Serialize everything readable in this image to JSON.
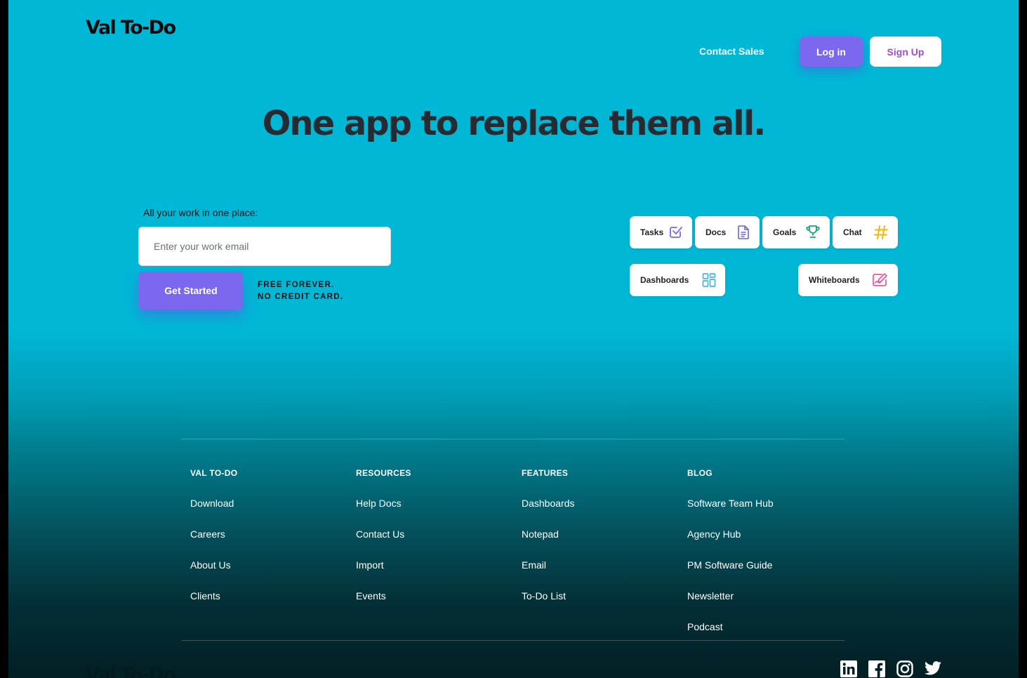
{
  "brand": {
    "name": "Val To-Do"
  },
  "nav": {
    "contact_sales": "Contact Sales",
    "login": "Log in",
    "signup": "Sign Up"
  },
  "hero": {
    "title": "One app to replace them all.",
    "email_label": "All your work in one place:",
    "email_placeholder": "Enter your work email",
    "cta": "Get Started",
    "note_line1": "FREE FOREVER.",
    "note_line2": "NO CREDIT CARD."
  },
  "features": [
    {
      "label": "Tasks",
      "icon": "check-square-icon",
      "color": "#7b68ee"
    },
    {
      "label": "Docs",
      "icon": "document-icon",
      "color": "#6e63d9"
    },
    {
      "label": "Goals",
      "icon": "trophy-icon",
      "color": "#1aa877"
    },
    {
      "label": "Chat",
      "icon": "hashtag-icon",
      "color": "#f7b500"
    },
    {
      "label": "Dashboards",
      "icon": "grid-icon",
      "color": "#49b6e0"
    },
    {
      "label": "Whiteboards",
      "icon": "whiteboard-icon",
      "color": "#e85a9f"
    }
  ],
  "footer": {
    "columns": [
      {
        "heading": "VAL TO-DO",
        "links": [
          "Download",
          "Careers",
          "About Us",
          "Clients"
        ]
      },
      {
        "heading": "RESOURCES",
        "links": [
          "Help Docs",
          "Contact Us",
          "Import",
          "Events"
        ]
      },
      {
        "heading": "FEATURES",
        "links": [
          "Dashboards",
          "Notepad",
          "Email",
          "To-Do List"
        ]
      },
      {
        "heading": "BLOG",
        "links": [
          "Software Team Hub",
          "Agency Hub",
          "PM Software Guide",
          "Newsletter",
          "Podcast"
        ]
      }
    ],
    "social": [
      "linkedin-icon",
      "facebook-icon",
      "instagram-icon",
      "twitter-icon"
    ]
  }
}
